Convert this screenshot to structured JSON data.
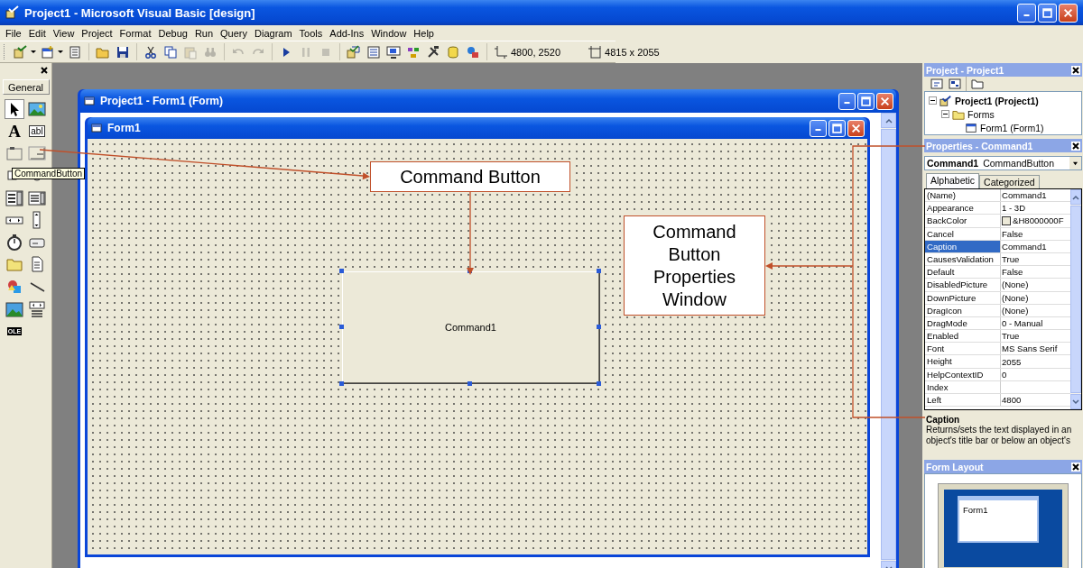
{
  "window": {
    "title": "Project1 - Microsoft Visual Basic [design]"
  },
  "menu": [
    "File",
    "Edit",
    "View",
    "Project",
    "Format",
    "Debug",
    "Run",
    "Query",
    "Diagram",
    "Tools",
    "Add-Ins",
    "Window",
    "Help"
  ],
  "toolbar": {
    "groups": [
      [
        {
          "kind": "add-project",
          "dropdown": true,
          "disabled": false
        },
        {
          "kind": "add-form",
          "dropdown": true,
          "disabled": false
        },
        {
          "kind": "menu-editor",
          "dropdown": false,
          "disabled": false
        }
      ],
      [
        {
          "kind": "open",
          "dropdown": false,
          "disabled": false
        },
        {
          "kind": "save",
          "dropdown": false,
          "disabled": false
        }
      ],
      [
        {
          "kind": "cut",
          "dropdown": false,
          "disabled": false
        },
        {
          "kind": "copy",
          "dropdown": false,
          "disabled": false
        },
        {
          "kind": "paste",
          "dropdown": false,
          "disabled": true
        },
        {
          "kind": "find",
          "dropdown": false,
          "disabled": true
        }
      ],
      [
        {
          "kind": "undo",
          "dropdown": false,
          "disabled": true
        },
        {
          "kind": "redo",
          "dropdown": false,
          "disabled": true
        }
      ],
      [
        {
          "kind": "start",
          "dropdown": false,
          "disabled": false
        },
        {
          "kind": "break",
          "dropdown": false,
          "disabled": true
        },
        {
          "kind": "end",
          "dropdown": false,
          "disabled": true
        }
      ],
      [
        {
          "kind": "project-explorer",
          "dropdown": false,
          "disabled": false
        },
        {
          "kind": "properties",
          "dropdown": false,
          "disabled": false
        },
        {
          "kind": "form-layout",
          "dropdown": false,
          "disabled": false
        },
        {
          "kind": "object-browser",
          "dropdown": false,
          "disabled": false
        },
        {
          "kind": "toolbox",
          "dropdown": false,
          "disabled": false
        },
        {
          "kind": "data-view",
          "dropdown": false,
          "disabled": false
        },
        {
          "kind": "component",
          "dropdown": false,
          "disabled": false
        }
      ]
    ],
    "position": "4800, 2520",
    "size": "4815 x 2055"
  },
  "toolbox": {
    "tab": "General",
    "tooltip": "CommandButton",
    "tools": [
      {
        "kind": "pointer",
        "selected": true
      },
      {
        "kind": "picture",
        "selected": false
      },
      {
        "kind": "glyph",
        "glyph": "A",
        "selected": false
      },
      {
        "kind": "textbox",
        "glyph": "abl",
        "selected": false
      },
      {
        "kind": "frame",
        "selected": false
      },
      {
        "kind": "command",
        "selected": false
      },
      {
        "kind": "checkbox",
        "selected": false
      },
      {
        "kind": "option",
        "selected": false
      },
      {
        "kind": "combo",
        "selected": false
      },
      {
        "kind": "list",
        "selected": false
      },
      {
        "kind": "hscroll",
        "selected": false
      },
      {
        "kind": "vscroll",
        "selected": false
      },
      {
        "kind": "timer",
        "selected": false
      },
      {
        "kind": "drive",
        "selected": false
      },
      {
        "kind": "folder",
        "selected": false
      },
      {
        "kind": "file",
        "selected": false
      },
      {
        "kind": "shape",
        "selected": false
      },
      {
        "kind": "line",
        "selected": false
      },
      {
        "kind": "image",
        "selected": false
      },
      {
        "kind": "data",
        "selected": false
      },
      {
        "kind": "ole",
        "glyph": "OLE",
        "selected": false
      }
    ]
  },
  "designer": {
    "title": "Project1 - Form1 (Form)",
    "form": {
      "title": "Form1",
      "button": {
        "caption": "Command1"
      }
    }
  },
  "annotations": [
    {
      "text": "Command Button"
    },
    {
      "text": "Command Button Properties Window"
    }
  ],
  "project_panel": {
    "title": "Project - Project1",
    "tree": [
      {
        "label": "Project1 (Project1)",
        "kind": "project",
        "expanded": true,
        "children": [
          {
            "label": "Forms",
            "kind": "folder",
            "expanded": true,
            "children": [
              {
                "label": "Form1 (Form1)",
                "kind": "form"
              }
            ]
          }
        ]
      }
    ]
  },
  "properties_panel": {
    "title": "Properties - Command1",
    "object": "Command1",
    "object_type": "CommandButton",
    "tabs": [
      {
        "label": "Alphabetic",
        "selected": true
      },
      {
        "label": "Categorized",
        "selected": false
      }
    ],
    "rows": [
      {
        "name": "(Name)",
        "value": "Command1",
        "kind": "text",
        "selected": false
      },
      {
        "name": "Appearance",
        "value": "1 - 3D",
        "kind": "text",
        "selected": false
      },
      {
        "name": "BackColor",
        "value": "&H8000000F",
        "kind": "color",
        "color": "#ece9d8",
        "selected": false
      },
      {
        "name": "Cancel",
        "value": "False",
        "kind": "text",
        "selected": false
      },
      {
        "name": "Caption",
        "value": "Command1",
        "kind": "text",
        "selected": true
      },
      {
        "name": "CausesValidation",
        "value": "True",
        "kind": "text",
        "selected": false
      },
      {
        "name": "Default",
        "value": "False",
        "kind": "text",
        "selected": false
      },
      {
        "name": "DisabledPicture",
        "value": "(None)",
        "kind": "text",
        "selected": false
      },
      {
        "name": "DownPicture",
        "value": "(None)",
        "kind": "text",
        "selected": false
      },
      {
        "name": "DragIcon",
        "value": "(None)",
        "kind": "text",
        "selected": false
      },
      {
        "name": "DragMode",
        "value": "0 - Manual",
        "kind": "text",
        "selected": false
      },
      {
        "name": "Enabled",
        "value": "True",
        "kind": "text",
        "selected": false
      },
      {
        "name": "Font",
        "value": "MS Sans Serif",
        "kind": "text",
        "selected": false
      },
      {
        "name": "Height",
        "value": "2055",
        "kind": "text",
        "selected": false
      },
      {
        "name": "HelpContextID",
        "value": "0",
        "kind": "text",
        "selected": false
      },
      {
        "name": "Index",
        "kind": "text",
        "selected": false
      },
      {
        "name": "Left",
        "value": "4800",
        "kind": "text",
        "selected": false
      }
    ],
    "description": {
      "title": "Caption",
      "text": "Returns/sets the text displayed in an object's title bar or below an object's"
    }
  },
  "form_layout": {
    "title": "Form Layout",
    "form_label": "Form1"
  }
}
